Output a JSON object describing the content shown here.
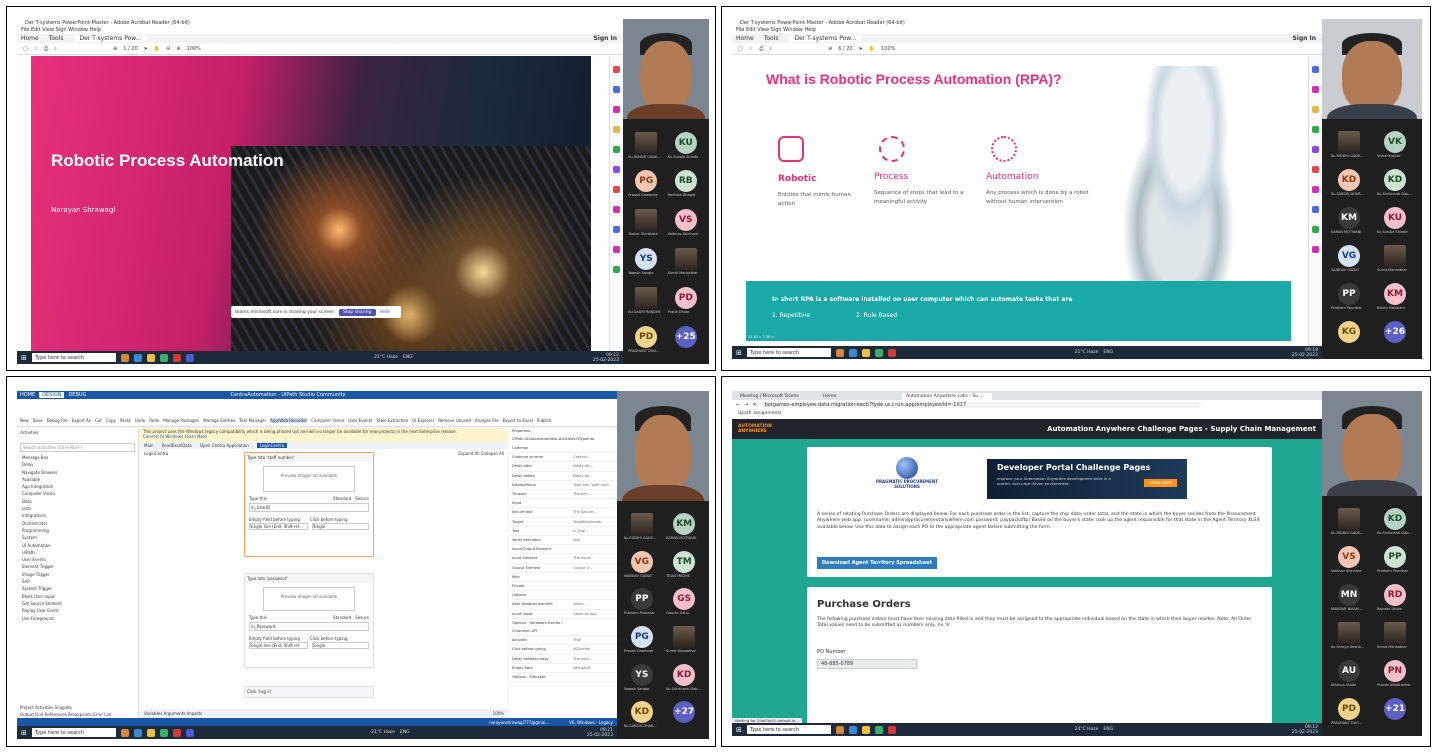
{
  "q1": {
    "title": "Der T-systems PowerPoint-Master - Adobe Acrobat Reader (64-bit)",
    "menu": "File  Edit  View  Sign  Window  Help",
    "tabs": [
      "Home",
      "Tools",
      "Der T-systems Pow..."
    ],
    "signin": "Sign In",
    "page": "1 / 20",
    "zoom": "100%",
    "slide_title": "Robotic Process Automation",
    "author": "Narayan Shrawagi",
    "share_text": "teams.microsoft.com is sharing your screen.",
    "stop_label": "Stop sharing",
    "hide_label": "Hide",
    "participants": [
      {
        "i": "",
        "n": "Ku.RIDDHI GADE..."
      },
      {
        "i": "KU",
        "n": "Ku.Suhaja Shinde"
      },
      {
        "i": "PG",
        "n": "Prasad Gawande"
      },
      {
        "i": "RB",
        "n": "Radhika Bhagat"
      },
      {
        "i": "",
        "n": "Tushar Shirbhate"
      },
      {
        "i": "VS",
        "n": "Vaibhav Shinhare"
      },
      {
        "i": "YS",
        "n": "Yogesh Sangle"
      },
      {
        "i": "",
        "n": "Sumit Mankathar"
      },
      {
        "i": "",
        "n": "Ku.GAURI RANDHE"
      },
      {
        "i": "PD",
        "n": "Pratik Dhote"
      },
      {
        "i": "PD",
        "n": "PRASHANT DHO..."
      },
      {
        "i": "+25",
        "n": ""
      }
    ]
  },
  "q2": {
    "title": "Der T-systems PowerPoint-Master - Adobe Acrobat Reader (64-bit)",
    "menu": "File  Edit  View  Sign  Window  Help",
    "tabs": [
      "Home",
      "Tools",
      "Der T-systems Pow..."
    ],
    "signin": "Sign In",
    "page": "6 / 20",
    "zoom": "100%",
    "heading": "What is Robotic Process Automation (RPA)?",
    "cols": [
      {
        "t": "Robotic",
        "d": "Entities that mimic human action"
      },
      {
        "t": "Process",
        "d": "Sequence of steps that lead to a meaningful activity"
      },
      {
        "t": "Automation",
        "d": "Any process which is done by a robot without human intervention"
      }
    ],
    "banner": "In short RPA is a software installed on user computer which can automate tasks that are",
    "items": [
      "1.  Repetitive",
      "2.  Rule Based"
    ],
    "size": "12.83 x 7.08 in",
    "participants": [
      {
        "i": "",
        "n": "Ku.RIDDHI GADE..."
      },
      {
        "i": "VK",
        "n": "Vishal Kakkar"
      },
      {
        "i": "KD",
        "n": "Ku.SAKSHI DHAR..."
      },
      {
        "i": "KD",
        "n": "Ku.Shrikhanti Dab..."
      },
      {
        "i": "KM",
        "n": "KARAN MOTWANI"
      },
      {
        "i": "KU",
        "n": "Ku.Suhaja Shinde"
      },
      {
        "i": "VG",
        "n": "VAIBHAV GANAT"
      },
      {
        "i": "",
        "n": "Sumit Mankathar"
      },
      {
        "i": "PP",
        "n": "Prathem Pounikar"
      },
      {
        "i": "KM",
        "n": "Kshitij Mahajani"
      },
      {
        "i": "KG",
        "n": ""
      },
      {
        "i": "+26",
        "n": ""
      }
    ]
  },
  "q3": {
    "menu_tabs": [
      "HOME",
      "DESIGN",
      "DEBUG"
    ],
    "title": "CentraAutomation - UiPath Studio Community",
    "ribbon": [
      "New",
      "Save",
      "Debug File",
      "Export As",
      "Cut",
      "Copy",
      "Paste",
      "Undo",
      "Redo",
      "Manage Packages",
      "Manage Entities",
      "Text Manager",
      "App/Web Recorder",
      "Computer Vision",
      "User Events",
      "Table Extraction",
      "UI Explorer",
      "Remove Unused",
      "Analyze File",
      "Export to Excel",
      "Publish"
    ],
    "warning": "This project uses the Windows legacy compatibility which is being phased out and will no longer be available for new projects in the next Enterprise release.",
    "warning2": "Convert to Windows  Learn More",
    "doc_tabs": [
      "Main",
      "ReadExcelData",
      "Open Centra Application",
      "LoginCentra"
    ],
    "breadcrumb": "LoginCentra",
    "expand": "Expand All   Collapse All",
    "activities_label": "Activities",
    "search_ph": "Search activities (Ctrl+Alt+F)",
    "tree": [
      "Message Box",
      "Delay",
      "Navigate Browser",
      "Available",
      "App Integration",
      "Computer Vision",
      "Data",
      "Lists",
      "Integrations",
      "Orchestrator",
      "Programming",
      "System",
      "UI Automation",
      "UiPath",
      "User Events",
      "Element Trigger",
      "Image Trigger",
      "SAP",
      "System Trigger",
      "Block User Input",
      "Get Source Element",
      "Replay User Event",
      "Use Foreground"
    ],
    "act1": {
      "title": "Type Into 'staff number'",
      "preview": "Preview image not available",
      "label": "Type this",
      "value": "in_UserID",
      "std": "Standard",
      "sec": "Secure",
      "f1": "Empty field before typing",
      "f2": "Click before typing",
      "v1": "Single line (End, Shift+H",
      "v2": "Single"
    },
    "act2": {
      "title": "Type Into 'password'",
      "preview": "Preview image not available",
      "label": "Type this",
      "value": "in_Password",
      "std": "Standard",
      "sec": "Secure",
      "f1": "Empty field before typing",
      "f2": "Click before typing",
      "v1": "Single line (End, Shift+H",
      "v2": "Single"
    },
    "act3": {
      "title": "Click 'Log in'"
    },
    "props_label": "Properties",
    "props_type": "UiPath.UIAutomationNext.Activities.NTypeInto",
    "props": [
      "Common",
      "Continue on error",
      "Delay after",
      "Delay before",
      "DisplayName",
      "Timeout",
      "Input",
      "Secure text",
      "Target",
      "Text",
      "Verify execution",
      "Input/Output Element",
      "Input Element",
      "Output Element",
      "Misc",
      "Private",
      "Options",
      "Alter disabled element",
      "Input mode",
      "Options - Hardware Events / Chromium API",
      "Activate",
      "Click before typing",
      "Delay between keys",
      "Empty field",
      "Options - Simulate"
    ],
    "prop_vals": [
      "",
      "Contain...",
      "Delay aft...",
      "Delay be...",
      "Type Into 'staff num",
      "The tim...",
      "",
      "The Secure...",
      "TargetAnchorab",
      "in_Use...",
      "Null",
      "",
      "The input...",
      "Output e...",
      "",
      "",
      "",
      "When...",
      "Same as App",
      "",
      "True",
      "NClickMo",
      "The dela...",
      "NEmptyFi",
      ""
    ],
    "bottom_tabs": "Variables  Arguments  Imports",
    "left_bottom": "Project  Activities  Snippets",
    "left_bottom2": "Output  Find References  Breakpoints  Error List",
    "zoom": "100%",
    "status": "narayanshrawagi777@gmai...",
    "status2": "V6, Windows - Legacy",
    "participants": [
      {
        "i": "",
        "n": "Ku.RIDDHI GADE..."
      },
      {
        "i": "KM",
        "n": "KARAN MOTWANI"
      },
      {
        "i": "VG",
        "n": "VAIBHAV GANAT"
      },
      {
        "i": "TM",
        "n": "TEJAS MEDHE"
      },
      {
        "i": "PP",
        "n": "Prathem Pounikar"
      },
      {
        "i": "GS",
        "n": "Gaurav Sahu"
      },
      {
        "i": "PG",
        "n": "Prasad Gawande"
      },
      {
        "i": "",
        "n": "Sumit Mankathar"
      },
      {
        "i": "YS",
        "n": "Yogesh Sangle"
      },
      {
        "i": "KD",
        "n": "Ku.Shrikhanti Dab..."
      },
      {
        "i": "KD",
        "n": "Ku.SAKSHI DHAR..."
      },
      {
        "i": "+27",
        "n": ""
      }
    ]
  },
  "q4": {
    "tabs": [
      "Meeting | Microsoft Teams",
      "Home",
      "Automation Anywhere Labs - Su..."
    ],
    "url": "botgames-employee-data-migration-eecb7fyde.uc.r.run.app/employee/id=-1017",
    "bookmark": "Upath assignments",
    "logo1": "AUTOMATION",
    "logo2": "ANYWHERE",
    "header": "Automation Anywhere Challenge Pages - Supply Chain Management",
    "pp1": "PRAGMATIC PROCUREMENT",
    "pp2": "SOLUTIONS",
    "dev_title": "Developer Portal Challenge Pages",
    "dev_sub": "Improve your Automation Anywhere development skills in a scored, user-case driven environment.",
    "learn": "LEARN MORE",
    "desc": "A series of rotating Purchase Orders are displayed below. For each purchase order in the list, capture the ship date, order total, and the state in which the buyer resides from the Procurement Anywhere web app. (username: admin@procurementanywhere.com password: paypacksftp) Based on the buyer's state, look up the agent responsible for that state in the Agent Territory XLSX available below. Use this data to assign each PO to the appropriate agent before submitting the form.",
    "download": "Download Agent Territory Spreadsheet",
    "po_title": "Purchase Orders",
    "po_desc": "The following purchase orders must have their missing data filled in and they must be assigned to the appropriate individual based on the state in which their buyer resides. Note: All Order Total values need to be submitted as numbers only, no '$'.",
    "po_label": "PO Number",
    "po_value": "48-885-0789",
    "waiting": "Waiting for 29b03b41.default.io...",
    "participants": [
      {
        "i": "",
        "n": "Ku.RIDDHI GADE..."
      },
      {
        "i": "KD",
        "n": "Ku.Shrikhanti Dab..."
      },
      {
        "i": "VS",
        "n": "Vaibhav Shinhare"
      },
      {
        "i": "PP",
        "n": "Prathem Pounikar"
      },
      {
        "i": "MN",
        "n": "MANDAR NIKAM..."
      },
      {
        "i": "RD",
        "n": "Rajneet Dhote"
      },
      {
        "i": "",
        "n": "Ku.Shreya Deshb..."
      },
      {
        "i": "",
        "n": "Sumit Mankathar"
      },
      {
        "i": "AU",
        "n": "Atharva Utade"
      },
      {
        "i": "PN",
        "n": "Pravan Nimbhorkar"
      },
      {
        "i": "PD",
        "n": "PRASHANT DHO..."
      },
      {
        "i": "+21",
        "n": ""
      }
    ]
  },
  "taskbar": {
    "search": "Type here to search",
    "weather1": "21°C Haze",
    "weather4": "24°C Haze",
    "lang": "ENG",
    "time1": "09:12",
    "time2": "09:19",
    "time3": "09:21",
    "time4": "09:12",
    "date": "25-02-2023"
  },
  "colors": {
    "acrobat_red": "#e02020",
    "teams_bg": "#1f1f1f",
    "uipath_blue": "#1a56a6",
    "aa_teal": "#1fa88f",
    "pink": "#e8317a",
    "teal": "#1aa9a7"
  }
}
